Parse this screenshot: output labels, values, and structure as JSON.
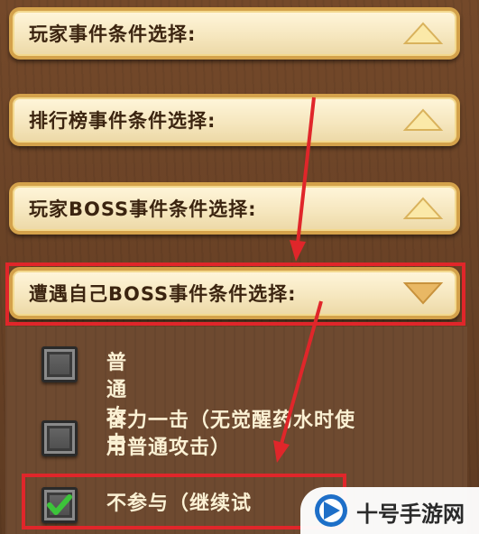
{
  "panels": [
    {
      "label": "玩家事件条件选择:",
      "expanded": false
    },
    {
      "label": "排行榜事件条件选择:",
      "expanded": false
    },
    {
      "label": "玩家BOSS事件条件选择:",
      "expanded": false
    },
    {
      "label": "遭遇自己BOSS事件条件选择:",
      "expanded": true
    }
  ],
  "options": [
    {
      "label": "普通攻击",
      "checked": false
    },
    {
      "label_line1": "奋力一击（无觉醒药水时使",
      "label_line2": "用普通攻击）",
      "checked": false
    },
    {
      "label": "不参与（继续试",
      "checked": true
    }
  ],
  "watermark": {
    "text": "十号手游网"
  },
  "colors": {
    "panel_border": "#d4a24b",
    "panel_fill": "#f6e7bf",
    "highlight": "#e0262a",
    "check": "#3cc43a",
    "background": "#6a4428"
  }
}
